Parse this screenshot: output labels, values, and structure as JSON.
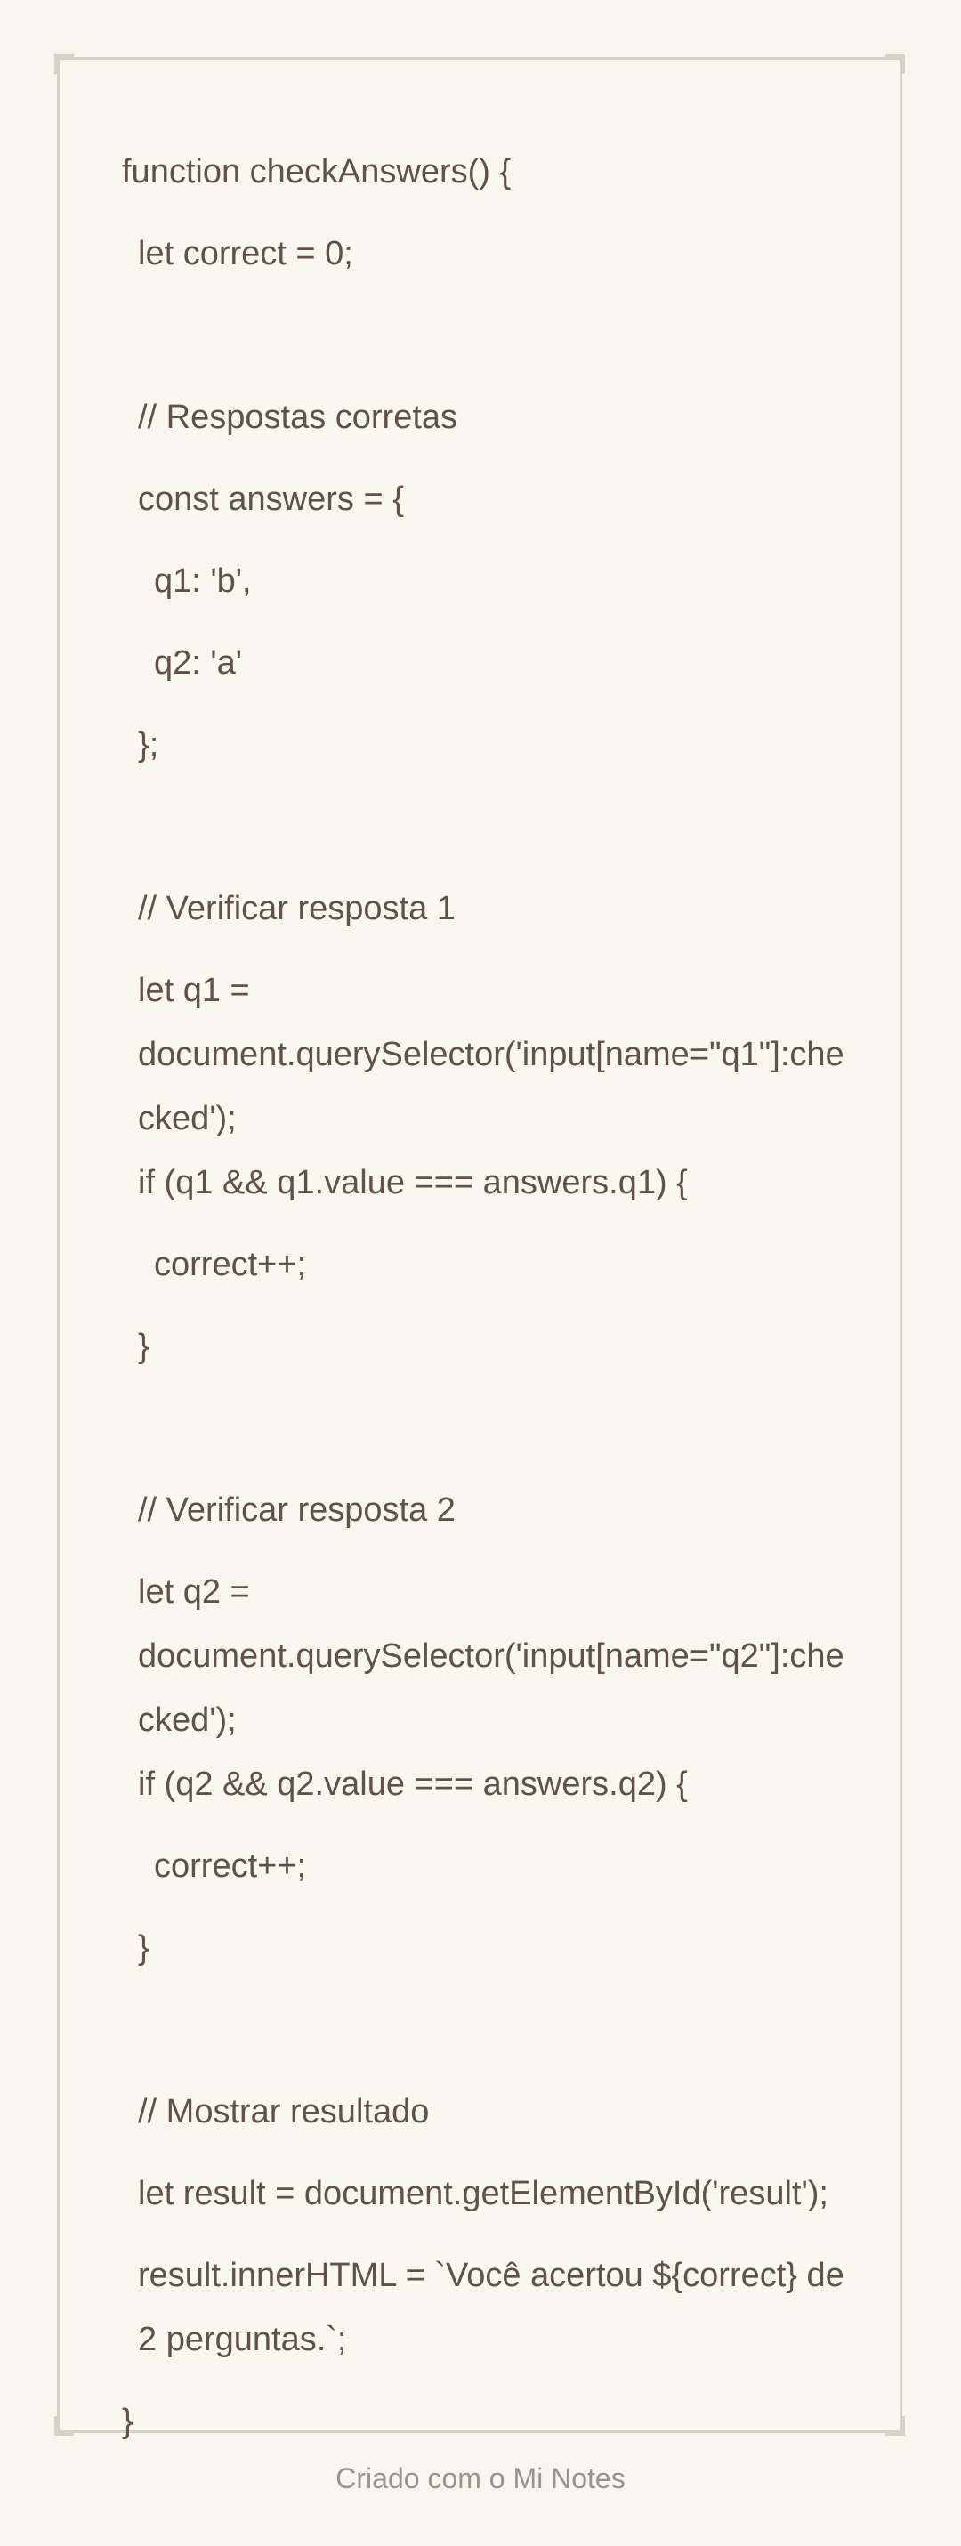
{
  "code_lines": [
    "function checkAnswers() {",
    "let correct = 0;",
    "",
    "// Respostas corretas",
    "const answers = {",
    "q1: 'b',",
    "q2: 'a'",
    "};",
    "",
    "// Verificar resposta 1",
    "let q1 = document.querySelector('input[name=\"q1\"]:checked');",
    "if (q1 && q1.value === answers.q1) {",
    "correct++;",
    "}",
    "",
    "// Verificar resposta 2",
    "let q2 = document.querySelector('input[name=\"q2\"]:checked');",
    "if (q2 && q2.value === answers.q2) {",
    "correct++;",
    "}",
    "",
    "// Mostrar resultado",
    "let result = document.getElementById('result');",
    "result.innerHTML = `Você acertou ${correct} de 2 perguntas.`;",
    "}"
  ],
  "footer": "Criado com o Mi Notes",
  "colors": {
    "background": "#f8f6ef",
    "text": "#5f524b",
    "footer_text": "#9a928c",
    "frame": "#d7d2c7"
  }
}
